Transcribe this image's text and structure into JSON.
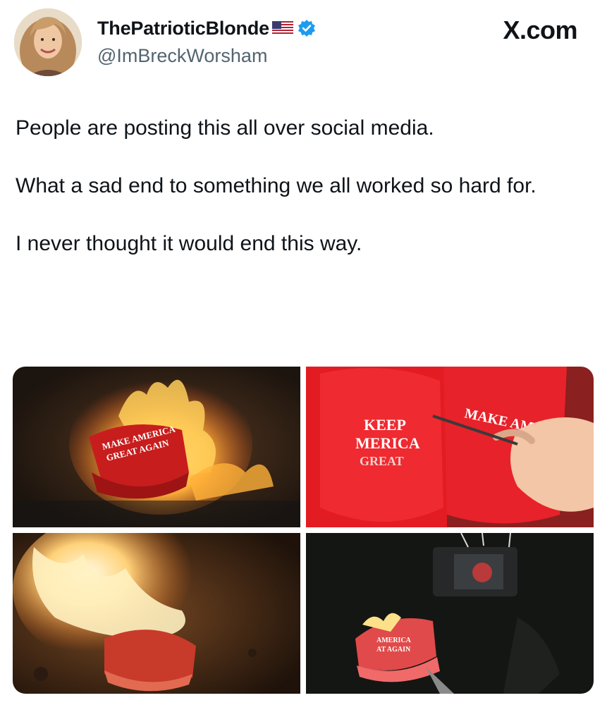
{
  "post": {
    "display_name": "ThePatrioticBlonde",
    "handle": "@ImBreckWorsham",
    "source": "X.com",
    "icons": {
      "flag": "us-flag-icon",
      "verified": "verified-badge-icon",
      "colors": {
        "verified": "#1d9bf0",
        "handle": "#536471"
      }
    },
    "paragraphs": [
      "People are posting this all over social media.",
      "What a sad end to something we all worked so hard for.",
      "I never thought it would end this way."
    ]
  },
  "media": {
    "images": [
      {
        "hat_text_line1": "MAKE AMERICA",
        "hat_text_line2": "GREAT AGAIN"
      },
      {
        "hat_left_line1": "KEEP",
        "hat_left_line2": "MERICA",
        "hat_left_line3": "GREAT",
        "hat_right_text": "MAKE AM"
      },
      {},
      {
        "hat_text_line1": "AMERICA",
        "hat_text_line2": "AT AGAIN"
      }
    ]
  }
}
